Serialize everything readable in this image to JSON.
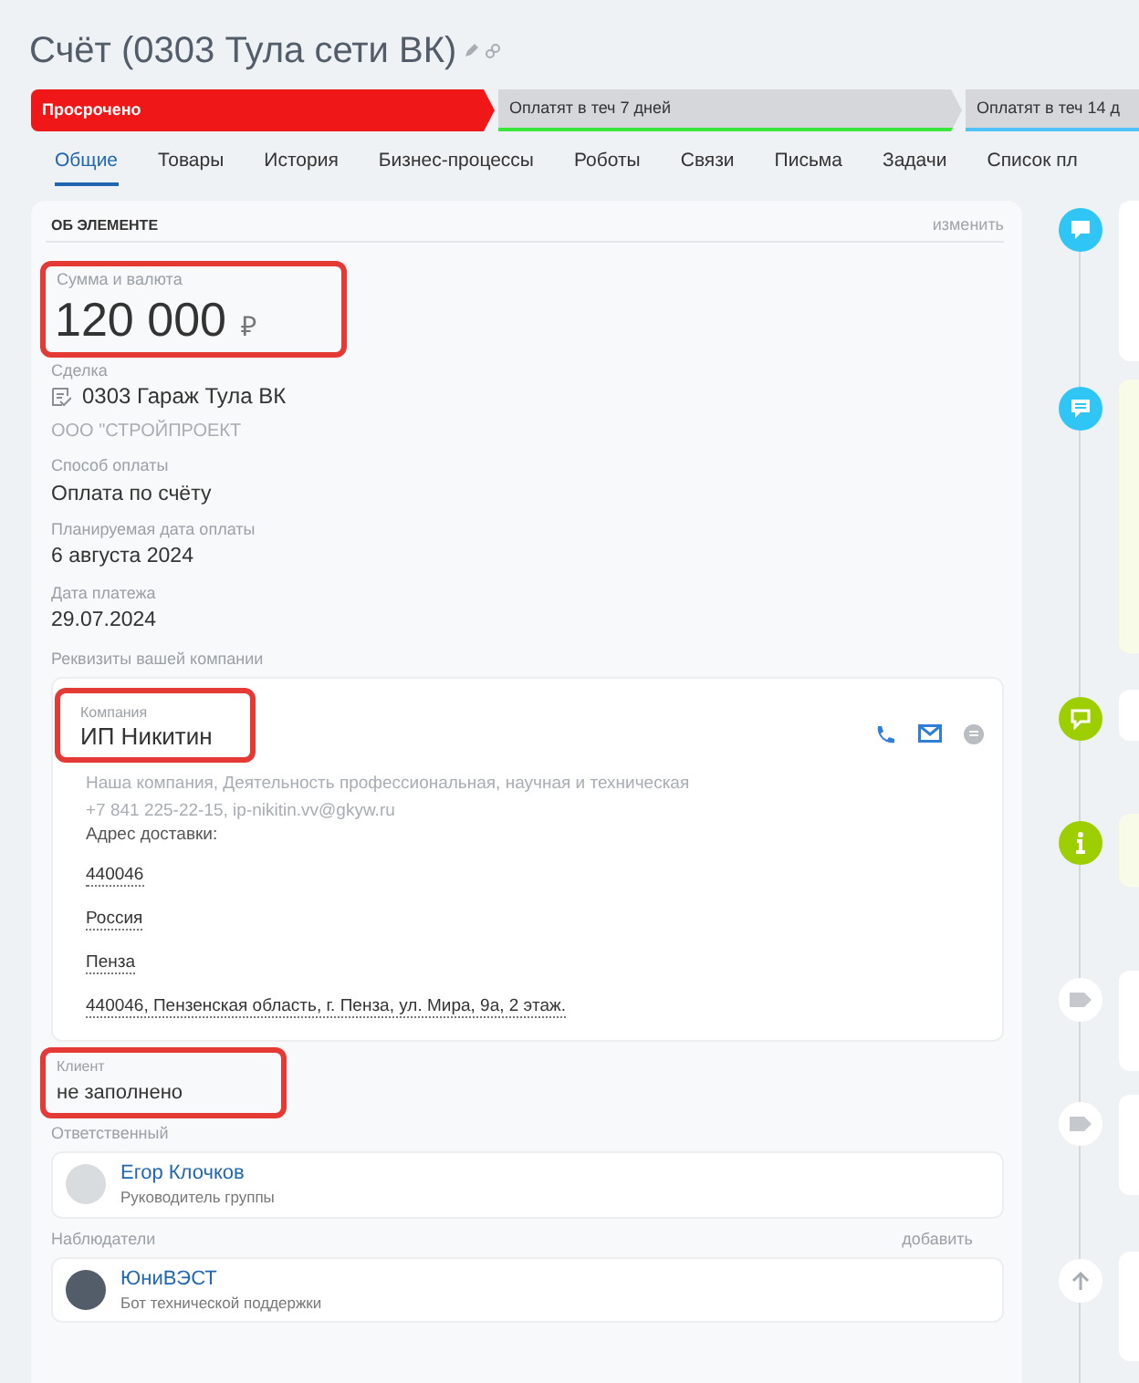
{
  "title": "Счёт (0303 Тула сети ВК)",
  "stages": [
    {
      "label": "Просрочено",
      "selected": true,
      "color": "#ef1717"
    },
    {
      "label": "Оплатят в теч 7 дней",
      "selected": false,
      "color": "#39e639"
    },
    {
      "label": "Оплатят в теч 14 д",
      "selected": false,
      "color": "#4fc3f7"
    }
  ],
  "tabs": [
    {
      "label": "Общие",
      "selected": true
    },
    {
      "label": "Товары",
      "selected": false
    },
    {
      "label": "История",
      "selected": false
    },
    {
      "label": "Бизнес-процессы",
      "selected": false
    },
    {
      "label": "Роботы",
      "selected": false
    },
    {
      "label": "Связи",
      "selected": false
    },
    {
      "label": "Письма",
      "selected": false
    },
    {
      "label": "Задачи",
      "selected": false
    },
    {
      "label": "Список пл",
      "selected": false
    }
  ],
  "section": {
    "title": "ОБ ЭЛЕМЕНТЕ",
    "action": "изменить"
  },
  "amount": {
    "label": "Сумма и валюта",
    "value": "120 000",
    "currency": "₽",
    "highlighted": true
  },
  "deal": {
    "label": "Сделка",
    "value": "0303 Гараж Тула ВК",
    "company": "ООО \"СТРОЙПРОЕКТ"
  },
  "fields": [
    {
      "label": "Способ оплаты",
      "value": "Оплата по счёту"
    },
    {
      "label": "Планируемая дата оплаты",
      "value": "6 августа 2024"
    },
    {
      "label": "Дата платежа",
      "value": "29.07.2024"
    }
  ],
  "requisites": {
    "label": "Реквизиты вашей компании",
    "company_label": "Компания",
    "company": "ИП Никитин",
    "highlighted": true,
    "description": "Наша компания, Деятельность профессиональная, научная и техническая",
    "contacts": "+7 841 225-22-15, ip-nikitin.vv@gkyw.ru",
    "address_label": "Адрес доставки:",
    "address_lines": [
      "440046",
      "Россия",
      "Пенза",
      "440046, Пензенская область, г. Пенза, ул. Мира, 9а, 2 этаж."
    ]
  },
  "client": {
    "label": "Клиент",
    "value": "не заполнено",
    "highlighted": true
  },
  "responsible": {
    "label": "Ответственный",
    "name": "Егор Клочков",
    "role": "Руководитель группы"
  },
  "observers": {
    "label": "Наблюдатели",
    "action": "добавить",
    "name": "ЮниВЭСТ",
    "role": "Бот технической поддержки"
  },
  "timeline": [
    {
      "kind": "comment",
      "color": "#2fc6f6"
    },
    {
      "kind": "note",
      "color": "#2fc6f6"
    },
    {
      "kind": "chat",
      "color": "#9dcf00"
    },
    {
      "kind": "info",
      "color": "#9dcf00"
    },
    {
      "kind": "tag",
      "color": "#ffffff"
    },
    {
      "kind": "tag",
      "color": "#ffffff"
    },
    {
      "kind": "up",
      "color": "#ffffff"
    }
  ]
}
